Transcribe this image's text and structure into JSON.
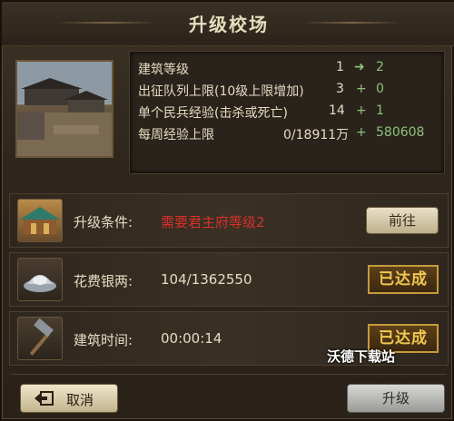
{
  "dialog": {
    "title": "升级校场"
  },
  "stats": [
    {
      "label": "建筑等级",
      "current": "1",
      "op": "➜",
      "new": "2"
    },
    {
      "label": "出征队列上限(10级上限增加)",
      "current": "3",
      "op": "+",
      "new": "0"
    },
    {
      "label": "单个民兵经验(击杀或死亡)",
      "current": "14",
      "op": "+",
      "new": "1"
    },
    {
      "label": "每周经验上限",
      "current": "0/18911万",
      "op": "+",
      "new": "580608"
    }
  ],
  "requirements": [
    {
      "label": "升级条件:",
      "value": "需要君主府等级2",
      "action": "前往"
    },
    {
      "label": "花费银两:",
      "value": "104/1362550",
      "status": "已达成"
    },
    {
      "label": "建筑时间:",
      "value": "00:00:14",
      "status": "已达成"
    }
  ],
  "footer": {
    "cancel": "取消",
    "upgrade": "升级"
  },
  "watermark": "沃德下载站",
  "colors": {
    "accent_green": "#8cc27a",
    "alert_red": "#d8302a",
    "gold": "#f1c752"
  }
}
